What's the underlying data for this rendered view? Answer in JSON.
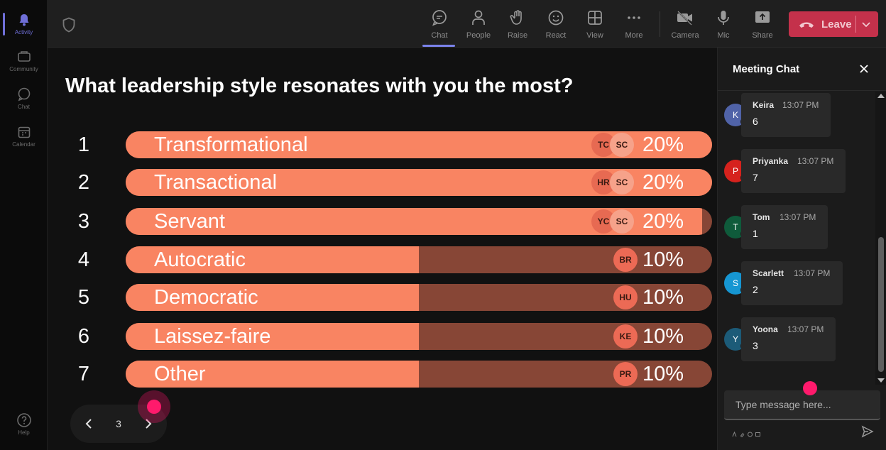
{
  "rail": {
    "items": [
      {
        "label": "Activity",
        "icon": "bell-icon",
        "active": true
      },
      {
        "label": "Community",
        "icon": "community-icon"
      },
      {
        "label": "Chat",
        "icon": "chat-icon"
      },
      {
        "label": "Calendar",
        "icon": "calendar-icon"
      }
    ],
    "help_label": "Help"
  },
  "toolbar": {
    "chat_label": "Chat",
    "people_label": "People",
    "raise_label": "Raise",
    "react_label": "React",
    "view_label": "View",
    "more_label": "More",
    "camera_label": "Camera",
    "mic_label": "Mic",
    "share_label": "Share",
    "leave_label": "Leave"
  },
  "poll": {
    "question": "What leadership style resonates with you the most?",
    "options": [
      {
        "rank": "1",
        "label": "Transformational",
        "percent_label": "20%",
        "percent": 0.2,
        "avatars": [
          "TC",
          "SC"
        ]
      },
      {
        "rank": "2",
        "label": "Transactional",
        "percent_label": "20%",
        "percent": 0.2,
        "avatars": [
          "HR",
          "SC"
        ]
      },
      {
        "rank": "3",
        "label": "Servant",
        "percent_label": "20%",
        "percent": 0.2,
        "avatars": [
          "YC",
          "SC"
        ]
      },
      {
        "rank": "4",
        "label": "Autocratic",
        "percent_label": "10%",
        "percent": 0.1,
        "avatars": [
          "BR"
        ]
      },
      {
        "rank": "5",
        "label": "Democratic",
        "percent_label": "10%",
        "percent": 0.1,
        "avatars": [
          "HU"
        ]
      },
      {
        "rank": "6",
        "label": "Laissez-faire",
        "percent_label": "10%",
        "percent": 0.1,
        "avatars": [
          "KE"
        ]
      },
      {
        "rank": "7",
        "label": "Other",
        "percent_label": "10%",
        "percent": 0.1,
        "avatars": [
          "PR"
        ]
      }
    ],
    "page_number": "3"
  },
  "chat": {
    "title": "Meeting Chat",
    "messages": [
      {
        "initial": "K",
        "name": "Keira",
        "time": "13:07 PM",
        "text": "6",
        "color": "#5063a8"
      },
      {
        "initial": "P",
        "name": "Priyanka",
        "time": "13:07 PM",
        "text": "7",
        "color": "#d6221d"
      },
      {
        "initial": "T",
        "name": "Tom",
        "time": "13:07 PM",
        "text": "1",
        "color": "#0f5b3b"
      },
      {
        "initial": "S",
        "name": "Scarlett",
        "time": "13:07 PM",
        "text": "2",
        "color": "#1696d2"
      },
      {
        "initial": "Y",
        "name": "Yoona",
        "time": "13:07 PM",
        "text": "3",
        "color": "#1c5b78"
      }
    ],
    "compose_placeholder": "Type message here..."
  },
  "colors": {
    "bar_fill": "#f98462",
    "bar_track": "#874636",
    "leave": "#c4314b",
    "accent": "#7b83eb",
    "cursor": "#ff1a6c"
  }
}
